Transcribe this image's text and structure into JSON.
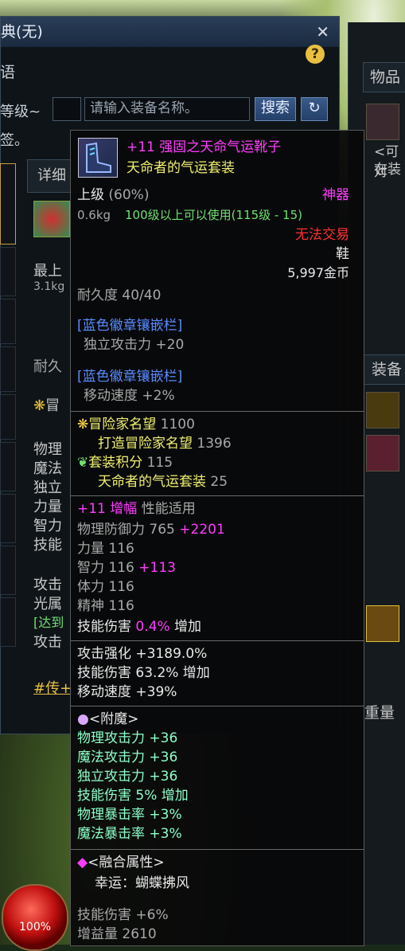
{
  "left_window": {
    "title": "典(无)",
    "tab_label": "语",
    "search": {
      "level_label": "等级~",
      "name_placeholder": "请输入装备名称。",
      "search_button": "搜索"
    },
    "filter_text": "签。",
    "detail_tab": "详细",
    "background_texts": [
      "最上",
      "3.1kg",
      "耐久",
      "冒",
      "物理",
      "魔法",
      "独立",
      "力量",
      "智力",
      "技能",
      "攻击",
      "光属",
      "[达到",
      "攻击",
      "#传+"
    ],
    "hp_percent": "100%"
  },
  "right_window": {
    "items_tab": "物品",
    "text_lines": [
      "<可对",
      "在装"
    ],
    "equip_tab": "装备",
    "weight_label": "重量"
  },
  "tooltip": {
    "name": "+11 强固之天命气运靴子",
    "set_name": "天命者的气运套装",
    "grade": "上级",
    "grade_percent": "(60%)",
    "rarity": "神器",
    "weight": "0.6kg",
    "level_requirement": "100级以上可以使用(115级 - 15)",
    "trade_status": "无法交易",
    "slot_type": "鞋",
    "price": "5,997金币",
    "durability": "耐久度 40/40",
    "emblem_sockets": [
      {
        "header": "[蓝色徽章镶嵌栏]",
        "stat": "独立攻击力 +20"
      },
      {
        "header": "[蓝色徽章镶嵌栏]",
        "stat": "移动速度 +2%"
      }
    ],
    "adventurer_fame": {
      "label": "冒险家名望",
      "value": "1100"
    },
    "forge_fame": {
      "label": "打造冒险家名望",
      "value": "1396"
    },
    "set_points": {
      "label": "套装积分",
      "value": "115"
    },
    "set_points_detail": {
      "label": "天命者的气运套装",
      "value": "25"
    },
    "amplify": {
      "level": "+11",
      "label": "增幅",
      "note": "性能适用"
    },
    "stats": [
      {
        "label": "物理防御力",
        "value": "765",
        "bonus": "+2201"
      },
      {
        "label": "力量",
        "value": "116",
        "bonus": ""
      },
      {
        "label": "智力",
        "value": "116",
        "bonus": "+113"
      },
      {
        "label": "体力",
        "value": "116",
        "bonus": ""
      },
      {
        "label": "精神",
        "value": "116",
        "bonus": ""
      }
    ],
    "skill_damage_line": {
      "label": "技能伤害",
      "value": "0.4%",
      "suffix": "增加"
    },
    "special_stats": [
      "攻击强化 +3189.0%",
      "技能伤害 63.2% 增加",
      "移动速度 +39%"
    ],
    "enchant": {
      "header": "<附魔>",
      "lines": [
        "物理攻击力 +36",
        "魔法攻击力 +36",
        "独立攻击力 +36",
        "技能伤害 5% 增加",
        "物理暴击率 +3%",
        "魔法暴击率 +3%"
      ]
    },
    "fusion": {
      "header": "<融合属性>",
      "luck": "幸运：蝴蝶拂风",
      "lines": [
        "技能伤害 +6%",
        "增益量 2610"
      ]
    }
  }
}
